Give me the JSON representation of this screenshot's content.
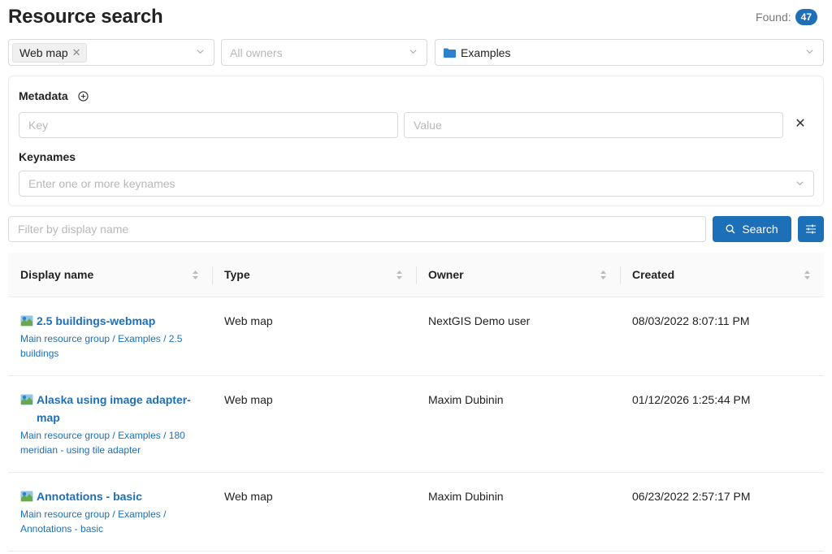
{
  "header": {
    "title": "Resource search",
    "found_label": "Found:",
    "found_count": "47"
  },
  "filters": {
    "type_tag": "Web map",
    "owner_placeholder": "All owners",
    "folder_value": "Examples"
  },
  "metadata": {
    "label": "Metadata",
    "key_placeholder": "Key",
    "value_placeholder": "Value",
    "keynames_label": "Keynames",
    "keynames_placeholder": "Enter one or more keynames"
  },
  "search": {
    "filter_placeholder": "Filter by display name",
    "button_label": "Search"
  },
  "table": {
    "columns": [
      "Display name",
      "Type",
      "Owner",
      "Created"
    ],
    "rows": [
      {
        "name": "2.5 buildings-webmap",
        "path": [
          "Main resource group",
          "Examples",
          "2.5 buildings"
        ],
        "type": "Web map",
        "owner": "NextGIS Demo user",
        "created": "08/03/2022 8:07:11 PM"
      },
      {
        "name": "Alaska using image adapter-map",
        "path": [
          "Main resource group",
          "Examples",
          "180 meridian - using tile adapter"
        ],
        "type": "Web map",
        "owner": "Maxim Dubinin",
        "created": "01/12/2026 1:25:44 PM"
      },
      {
        "name": "Annotations - basic",
        "path": [
          "Main resource group",
          "Examples",
          "Annotations - basic"
        ],
        "type": "Web map",
        "owner": "Maxim Dubinin",
        "created": "06/23/2022 2:57:17 PM"
      }
    ]
  },
  "colors": {
    "accent": "#1d6fb8"
  }
}
